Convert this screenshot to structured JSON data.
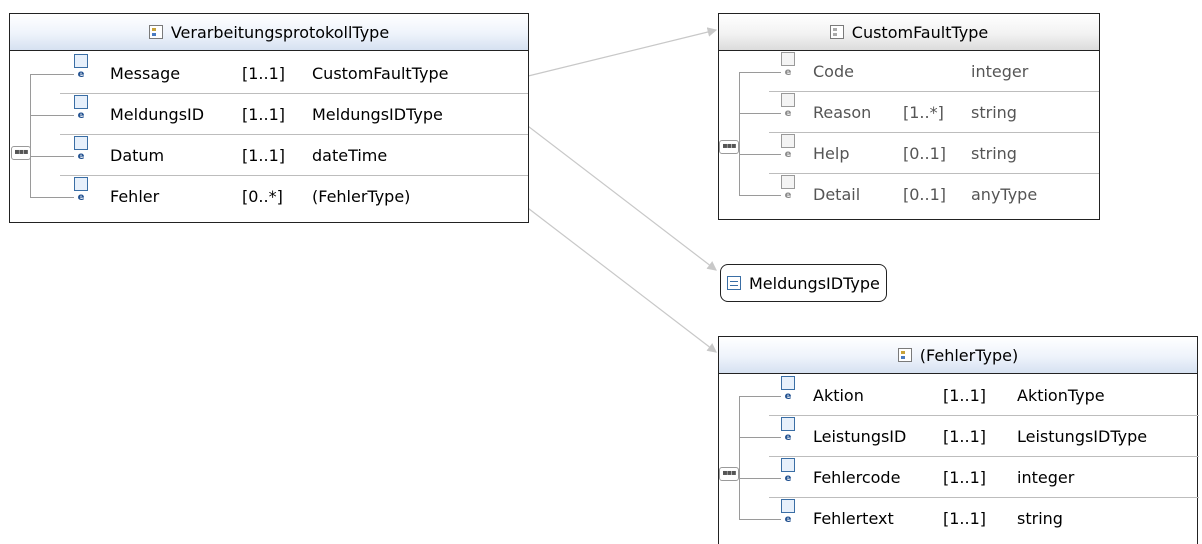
{
  "types": [
    {
      "id": "verarbeitungsprotokoll",
      "name": "VerarbeitungsprotokollType",
      "style": "active",
      "elements": [
        {
          "name": "Message",
          "cardinality": "[1..1]",
          "type": "CustomFaultType"
        },
        {
          "name": "MeldungsID",
          "cardinality": "[1..1]",
          "type": "MeldungsIDType"
        },
        {
          "name": "Datum",
          "cardinality": "[1..1]",
          "type": "dateTime"
        },
        {
          "name": "Fehler",
          "cardinality": "[0..*]",
          "type": "(FehlerType)"
        }
      ]
    },
    {
      "id": "customfault",
      "name": "CustomFaultType",
      "style": "inherited",
      "elements": [
        {
          "name": "Code",
          "cardinality": "",
          "type": "integer"
        },
        {
          "name": "Reason",
          "cardinality": "[1..*]",
          "type": "string"
        },
        {
          "name": "Help",
          "cardinality": "[0..1]",
          "type": "string"
        },
        {
          "name": "Detail",
          "cardinality": "[0..1]",
          "type": "anyType"
        }
      ]
    },
    {
      "id": "fehlertype",
      "name": "(FehlerType)",
      "style": "active",
      "elements": [
        {
          "name": "Aktion",
          "cardinality": "[1..1]",
          "type": "AktionType"
        },
        {
          "name": "LeistungsID",
          "cardinality": "[1..1]",
          "type": "LeistungsIDType"
        },
        {
          "name": "Fehlercode",
          "cardinality": "[1..1]",
          "type": "integer"
        },
        {
          "name": "Fehlertext",
          "cardinality": "[1..1]",
          "type": "string"
        }
      ]
    }
  ],
  "simple_type": {
    "name": "MeldungsIDType"
  },
  "icons": {
    "element": "e",
    "complex_type": "complex-type-icon",
    "simple_type": "simple-type-icon",
    "sequence": "sequence-compositor-icon"
  },
  "colors": {
    "header_active": "#d6e1f1",
    "header_inherited": "#dcdcdc",
    "connector": "#c8c8c8",
    "border": "#222222"
  }
}
